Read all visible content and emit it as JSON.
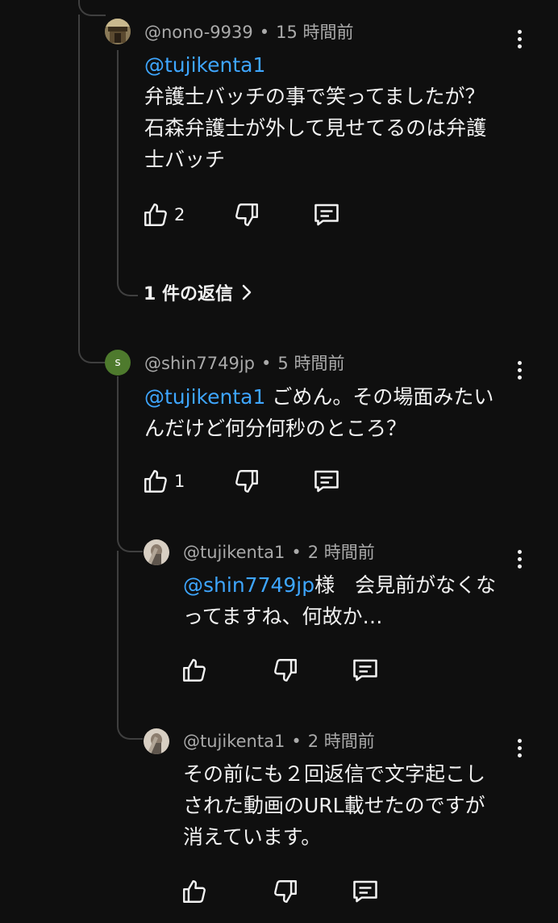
{
  "comments": [
    {
      "author": "@nono-9939",
      "time": "15 時間前",
      "mention": "@tujikenta1",
      "text_lines": [
        "弁護士バッチの事で笑ってましたが？",
        "石森弁護士が外して見せてるのは弁護",
        "士バッチ"
      ],
      "likes": "2",
      "replies_label": "1 件の返信"
    },
    {
      "author": "@shin7749jp",
      "avatar_letter": "s",
      "avatar_color": "#4e7a2d",
      "time": "5 時間前",
      "mention": "@tujikenta1",
      "text_lines": [
        "ごめん。その場面みたい",
        "んだけど何分何秒のところ？"
      ],
      "likes": "1"
    },
    {
      "author": "@tujikenta1",
      "time": "2 時間前",
      "mention": "@shin7749jp",
      "text_lines": [
        "様　会見前がなくな",
        "ってますね、何故か…"
      ]
    },
    {
      "author": "@tujikenta1",
      "time": "2 時間前",
      "text_lines": [
        "その前にも２回返信で文字起こし",
        "された動画のURL載せたのですが",
        "消えています。"
      ]
    }
  ],
  "separator": "•",
  "colors": {
    "mention": "#3ea6ff",
    "background": "#0f0f0f",
    "meta": "#aaaaaa"
  },
  "icons": [
    "like-icon",
    "dislike-icon",
    "reply-icon",
    "more-vert-icon",
    "chevron-right-icon"
  ]
}
